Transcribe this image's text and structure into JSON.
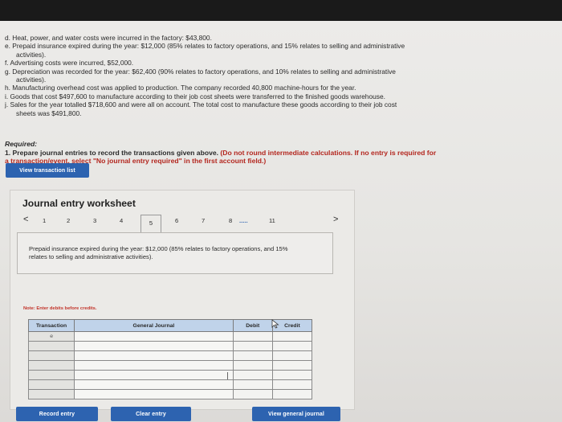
{
  "problem": {
    "lines": [
      "d. Heat, power, and water costs were incurred in the factory: $43,800.",
      "e. Prepaid insurance expired during the year: $12,000 (85% relates to factory operations, and 15% relates to selling and administrative",
      "activities).",
      "f. Advertising costs were incurred, $52,000.",
      "g. Depreciation was recorded for the year: $62,400 (90% relates to factory operations, and 10% relates to selling and administrative",
      "activities).",
      "h. Manufacturing overhead cost was applied to production. The company recorded 40,800 machine-hours for the year.",
      "i. Goods that cost $497,600 to manufacture according to their job cost sheets were transferred to the finished goods warehouse.",
      "j. Sales for the year totalled $718,600 and were all on account. The total cost to manufacture these goods according to their job cost",
      "sheets was $491,800."
    ]
  },
  "required": {
    "title": "Required:",
    "text": "1. Prepare journal entries to record the transactions given above.",
    "instruction_line1": "(Do not round intermediate calculations. If no entry is required for",
    "instruction_line2": "a transaction/event, select \"No journal entry required\" in the first account field.)"
  },
  "buttons": {
    "view_transaction_list": "View transaction list",
    "record_entry": "Record entry",
    "clear_entry": "Clear entry",
    "view_general_journal": "View general journal"
  },
  "worksheet": {
    "title": "Journal entry worksheet",
    "tabs": [
      "1",
      "2",
      "3",
      "4",
      "5",
      "6",
      "7",
      "8",
      ".....",
      "11"
    ],
    "active_tab": "5",
    "prev_arrow": "<",
    "next_arrow": ">",
    "prompt": "Prepaid insurance expired during the year: $12,000 (85% relates to factory operations, and 15% relates to selling and administrative activities).",
    "note": "Note: Enter debits before credits.",
    "columns": {
      "transaction": "Transaction",
      "general_journal": "General Journal",
      "debit": "Debit",
      "credit": "Credit"
    },
    "rows": [
      {
        "transaction": "e",
        "account": "",
        "debit": "",
        "credit": ""
      },
      {
        "transaction": "",
        "account": "",
        "debit": "",
        "credit": ""
      },
      {
        "transaction": "",
        "account": "",
        "debit": "",
        "credit": ""
      },
      {
        "transaction": "",
        "account": "",
        "debit": "",
        "credit": ""
      },
      {
        "transaction": "",
        "account": "",
        "debit": "",
        "credit": ""
      },
      {
        "transaction": "",
        "account": "",
        "debit": "",
        "credit": ""
      },
      {
        "transaction": "",
        "account": "",
        "debit": "",
        "credit": ""
      }
    ]
  },
  "colors": {
    "button_blue": "#2d63b0",
    "header_blue": "#c0d3ea",
    "note_red": "#c2342a"
  }
}
